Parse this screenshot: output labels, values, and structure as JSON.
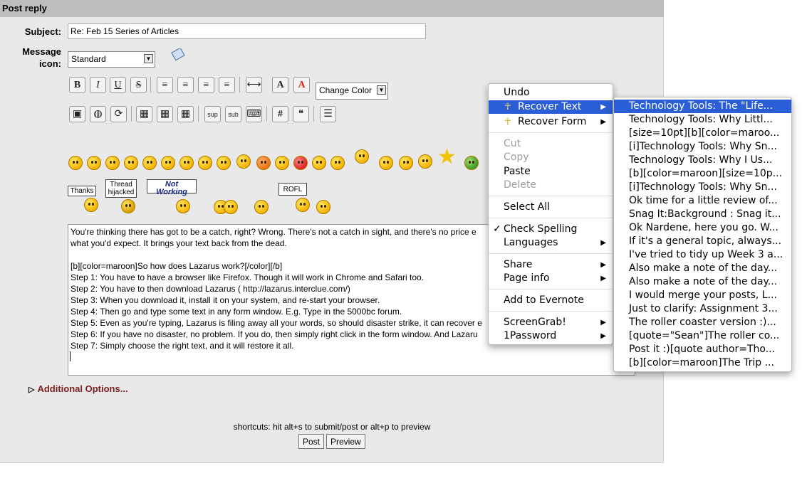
{
  "form": {
    "title": "Post reply",
    "subject_label": "Subject:",
    "subject_value": "Re: Feb 15 Series of Articles",
    "icon_label_1": "Message",
    "icon_label_2": "icon:",
    "icon_select": "Standard",
    "color_select": "Change Color"
  },
  "toolbar": {
    "bold": "B",
    "italic": "I",
    "underline": "U",
    "strike": "S",
    "font_size": "A",
    "font_color": "A",
    "hash": "#",
    "sup": "sup",
    "sub": "sub"
  },
  "signs": {
    "thanks": "Thanks",
    "thread1": "Thread",
    "thread2": "hijacked",
    "notworking": "Not Working",
    "rofl": "ROFL"
  },
  "editor": {
    "text": "You're thinking there has got to be a catch, right? Wrong. There's not a catch in sight, and there's no price e                            does just\nwhat you'd expect. It brings your text back from the dead.\n\n[b][color=maroon]So how does Lazarus work?[/color][/b]\nStep 1: You have to have a browser like Firefox. Though it will work in Chrome and Safari too.\nStep 2: You have to then download Lazarus ( http://lazarus.interclue.com/)\nStep 3: When you download it, install it on your system, and re-start your browser.\nStep 4: Then go and type some text in any form window. E.g. Type in the 5000bc forum.\nStep 5: Even as you're typing, Lazarus is filing away all your words, so should disaster strike, it can recover e\nStep 6: If you have no disaster, no problem. If you do, then simply right click in the form window. And Lazaru                          e graphic below)\nStep 7: Simply choose the right text, and it will restore it all."
  },
  "additional_options": "Additional Options...",
  "shortcuts": "shortcuts: hit alt+s to submit/post or alt+p to preview",
  "buttons": {
    "post": "Post",
    "preview": "Preview"
  },
  "context_menu": {
    "items": [
      "Undo",
      "Recover Text",
      "Recover Form",
      "Cut",
      "Copy",
      "Paste",
      "Delete",
      "Select All",
      "Check Spelling",
      "Languages",
      "Share",
      "Page info",
      "Add to Evernote",
      "ScreenGrab!",
      "1Password"
    ]
  },
  "recover_submenu": [
    "Technology Tools: The \"Life...",
    "Technology Tools: Why Littl...",
    "[size=10pt][b][color=maroo...",
    "[i]Technology Tools: Why Sn...",
    "Technology Tools: Why I Us...",
    "[b][color=maroon][size=10p...",
    "[i]Technology Tools: Why Sn...",
    "Ok time for a little review of...",
    "Snag It:Background : Snag it...",
    "Ok Nardene, here you go. W...",
    "If it's a general topic, always...",
    "I've tried to tidy up Week 3 a...",
    "Also make a note of the day...",
    "Also make a note of the day...",
    "I would merge your posts, L...",
    "Just to clarify: Assignment 3...",
    "The roller coaster version :)...",
    "[quote=\"Sean\"]The roller co...",
    "Post it :)[quote author=Tho...",
    "[b][color=maroon]The Trip ..."
  ]
}
